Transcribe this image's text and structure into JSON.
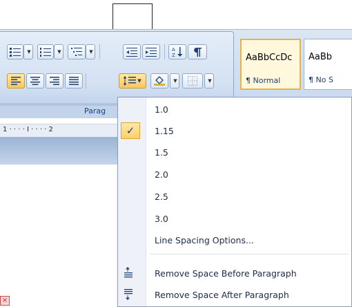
{
  "ribbon": {
    "group_label": "Parag",
    "styles": [
      {
        "preview": "AaBbCcDc",
        "name": "¶ Normal",
        "selected": true
      },
      {
        "preview": "AaBb",
        "name": "¶ No S",
        "selected": false
      }
    ]
  },
  "ruler": {
    "text": "1 · · · · I · · · · 2"
  },
  "line_spacing_menu": {
    "options": [
      {
        "label": "1.0",
        "checked": false
      },
      {
        "label": "1.15",
        "checked": true
      },
      {
        "label": "1.5",
        "checked": false
      },
      {
        "label": "2.0",
        "checked": false
      },
      {
        "label": "2.5",
        "checked": false
      },
      {
        "label": "3.0",
        "checked": false
      }
    ],
    "options_link": "Line Spacing Options...",
    "remove_before": "Remove Space Before Paragraph",
    "remove_after": "Remove Space After Paragraph",
    "check_glyph": "✓"
  },
  "colors": {
    "accent": "#ffc65a",
    "ribbon": "#d5e2f3",
    "menu_text": "#1b2b4a"
  }
}
